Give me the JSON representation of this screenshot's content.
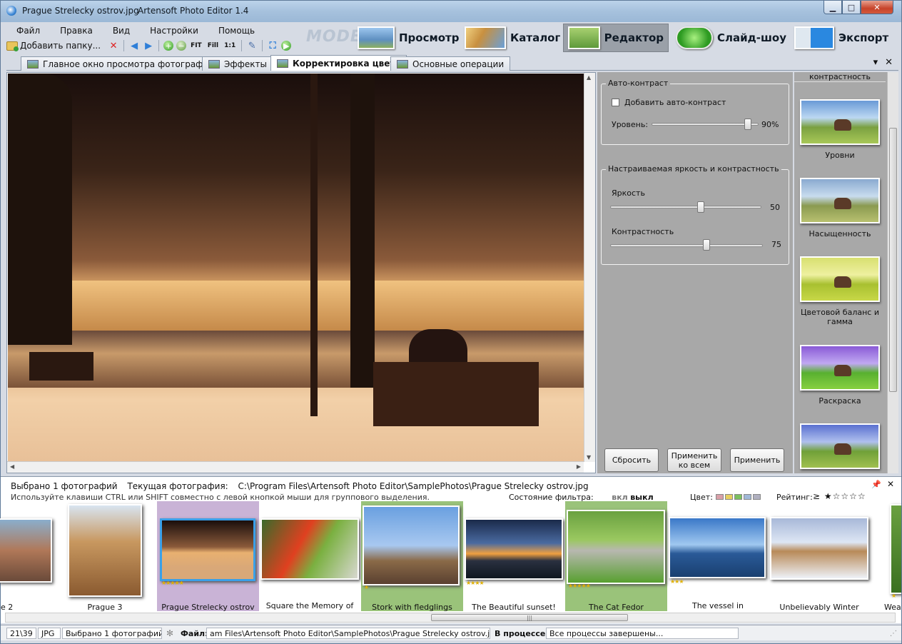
{
  "window": {
    "title": "Prague Strelecky ostrov.jpg",
    "app_name": "Artensoft Photo Editor 1.4",
    "min_glyph": "▁",
    "max_glyph": "□",
    "close_glyph": "✕"
  },
  "menu": [
    "Файл",
    "Правка",
    "Вид",
    "Настройки",
    "Помощь"
  ],
  "toolbar": {
    "add_folder_label": "Добавить папку...",
    "fit_label": "FIT",
    "fill_label": "Fill",
    "one_to_one_label": "1:1"
  },
  "mode": {
    "label": "MODE:",
    "buttons": [
      {
        "label": "Просмотр",
        "active": false
      },
      {
        "label": "Каталог",
        "active": false
      },
      {
        "label": "Редактор",
        "active": true
      },
      {
        "label": "Слайд-шоу",
        "active": false
      },
      {
        "label": "Экспорт",
        "active": false
      }
    ]
  },
  "tabs": [
    {
      "label": "Главное окно просмотра фотографии",
      "active": false
    },
    {
      "label": "Эффекты",
      "active": false
    },
    {
      "label": "Корректировка цвета",
      "active": true
    },
    {
      "label": "Основные операции",
      "active": false
    }
  ],
  "auto_contrast": {
    "title": "Авто-контраст",
    "checkbox_label": "Добавить авто-контраст",
    "checked": false,
    "level_label": "Уровень:",
    "level_value": "90%",
    "level_fraction": 0.9
  },
  "brightness_contrast": {
    "title": "Настраиваемая яркость и контрастность",
    "brightness_label": "Яркость",
    "brightness_value": "50",
    "brightness_fraction": 0.6,
    "contrast_label": "Контрастность",
    "contrast_value": "75",
    "contrast_fraction": 0.63
  },
  "buttons": {
    "reset": "Сбросить",
    "apply_all": "Применить ко всем",
    "apply": "Применить"
  },
  "effects": {
    "top_label": "контрастность",
    "items": [
      "Уровни",
      "Насыщенность",
      "Цветовой баланс и гамма",
      "Раскраска",
      ""
    ]
  },
  "browser": {
    "selected_info": "Выбрано 1  фотографий",
    "current_label": "Текущая фотография:",
    "current_path": "C:\\Program Files\\Artensoft Photo Editor\\SamplePhotos\\Prague Strelecky ostrov.jpg",
    "hint": "Используйте клавиши CTRL или SHIFT совместно с левой кнопкой мыши для группового выделения.",
    "filter_label": "Состояние фильтра:",
    "filter_on": "вкл",
    "filter_off": "выкл",
    "color_label": "Цвет:",
    "color_swatches": [
      "#d9a0a8",
      "#e8d060",
      "#7cc060",
      "#a0b8d8",
      "#b0b0c0"
    ],
    "rating_label": "Рейтинг:",
    "rating_glyphs": "≥ ★☆☆☆☆",
    "thumbnails": [
      {
        "caption": "e 2",
        "stars": "",
        "selected": ""
      },
      {
        "caption": "Prague 3",
        "stars": "",
        "selected": ""
      },
      {
        "caption": "Prague Strelecky ostrov",
        "stars": "★★★★★",
        "selected": "purple"
      },
      {
        "caption": "Square the Memory of",
        "stars": "",
        "selected": ""
      },
      {
        "caption": "Stork with fledglings",
        "stars": "★",
        "selected": "green"
      },
      {
        "caption": "The Beautiful sunset!",
        "stars": "★★★★",
        "selected": ""
      },
      {
        "caption": "The Cat Fedor",
        "stars": "★★★★★",
        "selected": "green"
      },
      {
        "caption": "The vessel in",
        "stars": "★★★",
        "selected": ""
      },
      {
        "caption": "Unbelievably Winter",
        "stars": "",
        "selected": ""
      },
      {
        "caption": "Wea",
        "stars": "★",
        "selected": ""
      }
    ],
    "scroll_grip": "|||"
  },
  "status": {
    "count": "21\\39",
    "format": "JPG",
    "selected": "Выбрано 1 фотографий",
    "file_label": "Файл:",
    "file_value": "am Files\\Artensoft Photo Editor\\SamplePhotos\\Prague Strelecky ostrov.jpg",
    "process_label": "В процессе:",
    "process_value": "Все процессы завершены..."
  }
}
